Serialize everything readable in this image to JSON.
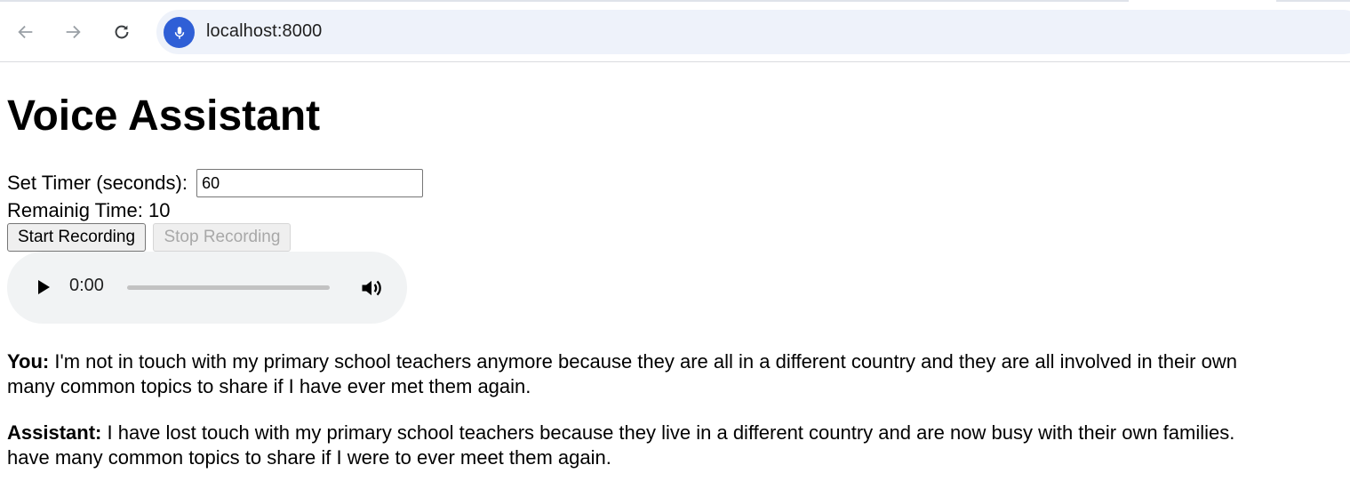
{
  "browser": {
    "url": "localhost:8000",
    "icons": [
      "back-arrow-icon",
      "forward-arrow-icon",
      "reload-icon",
      "microphone-icon"
    ],
    "mic_badge_color": "#2f5fd6"
  },
  "page": {
    "title": "Voice Assistant",
    "timer_label": "Set Timer (seconds):",
    "timer_value": "60",
    "remaining_label": "Remainig Time:",
    "remaining_value": "10",
    "start_button": "Start Recording",
    "stop_button": "Stop Recording"
  },
  "audio": {
    "current_time": "0:00",
    "icons": [
      "play-icon",
      "volume-icon"
    ]
  },
  "conversation": [
    {
      "speaker": "You:",
      "text": "I'm not in touch with my primary school teachers anymore because they are all in a different country and they are all involved in their own"
    },
    {
      "speaker": "",
      "text": "many common topics to share if I have ever met them again."
    },
    {
      "speaker": "Assistant:",
      "text": "I have lost touch with my primary school teachers because they live in a different country and are now busy with their own families."
    },
    {
      "speaker": "",
      "text": "have many common topics to share if I were to ever meet them again."
    }
  ]
}
